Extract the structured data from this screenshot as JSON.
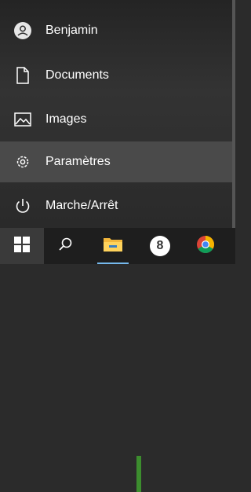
{
  "menu": {
    "items": [
      {
        "label": "Benjamin",
        "icon": "user-avatar-icon"
      },
      {
        "label": "Documents",
        "icon": "document-icon"
      },
      {
        "label": "Images",
        "icon": "image-icon"
      },
      {
        "label": "Paramètres",
        "icon": "gear-icon"
      },
      {
        "label": "Marche/Arrêt",
        "icon": "power-icon"
      }
    ]
  },
  "taskbar": {
    "buttons": [
      {
        "icon": "windows-start-icon"
      },
      {
        "icon": "search-icon"
      },
      {
        "icon": "file-explorer-icon"
      },
      {
        "icon": "app-8-icon"
      },
      {
        "icon": "chrome-icon"
      }
    ],
    "app8_label": "8"
  },
  "colors": {
    "background": "#2b2b2b",
    "hover": "#4a4a4a",
    "taskbar": "#1e1e1e",
    "accent": "#76b9ed"
  }
}
